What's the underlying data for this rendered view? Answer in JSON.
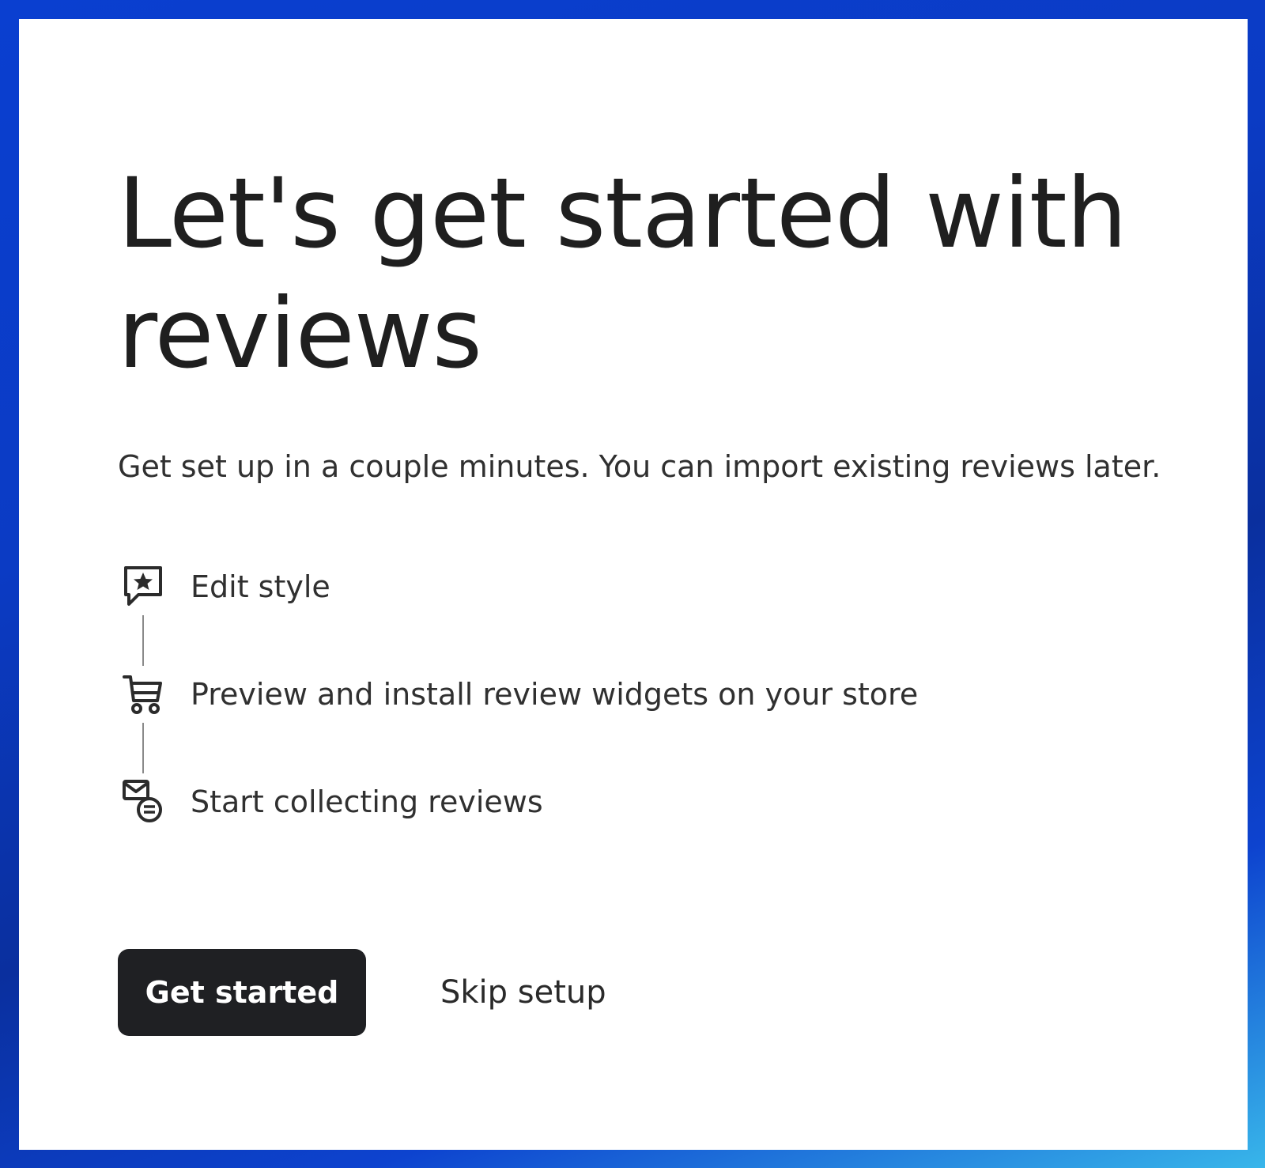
{
  "page": {
    "title_line1": "Let's get started with",
    "title_line2": "reviews",
    "subtitle": "Get set up in a couple minutes. You can import existing reviews later."
  },
  "steps": [
    {
      "label": "Edit style",
      "icon": "star-chat-bubble-icon"
    },
    {
      "label": "Preview and install review widgets on your store",
      "icon": "shopping-cart-icon"
    },
    {
      "label": "Start collecting reviews",
      "icon": "mail-chat-icon"
    }
  ],
  "actions": {
    "primary_label": "Get started",
    "secondary_label": "Skip setup"
  },
  "colors": {
    "primary_button_bg": "#1f2023",
    "text": "#303030",
    "frame_gradient_start": "#0a3fd0",
    "frame_gradient_end": "#38b6ea"
  }
}
